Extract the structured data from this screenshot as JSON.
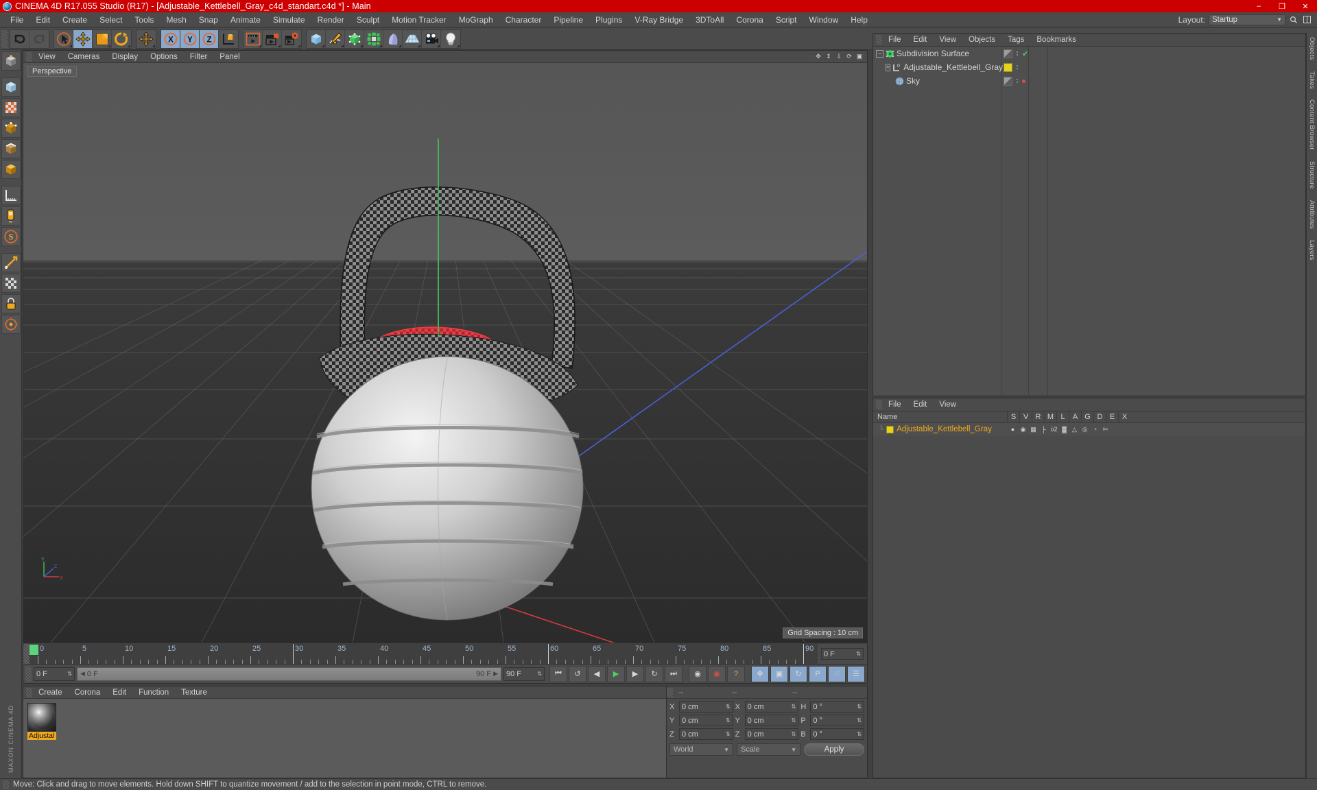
{
  "window": {
    "title": "CINEMA 4D R17.055 Studio (R17) - [Adjustable_Kettlebell_Gray_c4d_standart.c4d *] - Main",
    "minimize": "–",
    "maximize": "❐",
    "close": "✕"
  },
  "menubar": {
    "items": [
      "File",
      "Edit",
      "Create",
      "Select",
      "Tools",
      "Mesh",
      "Snap",
      "Animate",
      "Simulate",
      "Render",
      "Sculpt",
      "Motion Tracker",
      "MoGraph",
      "Character",
      "Pipeline",
      "Plugins",
      "V-Ray Bridge",
      "3DToAll",
      "Corona",
      "Script",
      "Window",
      "Help"
    ],
    "layout_label": "Layout:",
    "layout_value": "Startup",
    "search_icon": "search-icon"
  },
  "viewport": {
    "menu": [
      "View",
      "Cameras",
      "Display",
      "Options",
      "Filter",
      "Panel"
    ],
    "label": "Perspective",
    "grid_spacing": "Grid Spacing : 10 cm",
    "axis": {
      "x": "X",
      "y": "Y",
      "z": "Z"
    }
  },
  "timeline": {
    "tick_labels": [
      "0",
      "5",
      "10",
      "15",
      "20",
      "25",
      "30",
      "35",
      "40",
      "45",
      "50",
      "55",
      "60",
      "65",
      "70",
      "75",
      "80",
      "85",
      "90"
    ],
    "frame_min": 0,
    "frame_max": 90,
    "current_frame_field": "0 F",
    "right_field": "0 F"
  },
  "playback": {
    "current_frame": "0 F",
    "range_start": "0 F",
    "range_end": "90 F",
    "end_field": "90 F",
    "buttons": [
      {
        "name": "go-to-start-button",
        "glyph": "⏮"
      },
      {
        "name": "previous-key-button",
        "glyph": "↺"
      },
      {
        "name": "step-back-button",
        "glyph": "◀"
      },
      {
        "name": "play-button",
        "glyph": "▶"
      },
      {
        "name": "step-forward-button",
        "glyph": "▶"
      },
      {
        "name": "next-key-button",
        "glyph": "↻"
      },
      {
        "name": "go-to-end-button",
        "glyph": "⏭"
      }
    ],
    "record_buttons": [
      {
        "name": "record-active-objects-button",
        "glyph": "◉"
      },
      {
        "name": "autokeying-button",
        "glyph": "◉"
      },
      {
        "name": "keyframe-selection-button",
        "glyph": "?"
      },
      {
        "name": "position-key-button",
        "glyph": "✥"
      },
      {
        "name": "scale-key-button",
        "glyph": "▣"
      },
      {
        "name": "rotation-key-button",
        "glyph": "↻"
      },
      {
        "name": "param-key-button",
        "glyph": "P"
      },
      {
        "name": "pla-key-button",
        "glyph": "⋮⋮"
      },
      {
        "name": "timeline-toggle-button",
        "glyph": "☰"
      }
    ]
  },
  "material_manager": {
    "menu": [
      "Create",
      "Corona",
      "Edit",
      "Function",
      "Texture"
    ],
    "materials": [
      {
        "name": "Adjustal",
        "thumb": "sphere-preview"
      }
    ]
  },
  "coordinates": {
    "header_dashes": [
      "--",
      "--",
      "--"
    ],
    "position": {
      "label_x": "X",
      "label_y": "Y",
      "label_z": "Z",
      "x": "0 cm",
      "y": "0 cm",
      "z": "0 cm"
    },
    "size": {
      "label_x": "X",
      "label_y": "Y",
      "label_z": "Z",
      "x": "0 cm",
      "y": "0 cm",
      "z": "0 cm"
    },
    "rotation": {
      "label_h": "H",
      "label_p": "P",
      "label_b": "B",
      "h": "0 °",
      "p": "0 °",
      "b": "0 °"
    },
    "coord_system": "World",
    "mode": "Scale",
    "apply_label": "Apply"
  },
  "object_manager": {
    "menu": [
      "File",
      "Edit",
      "View",
      "Objects",
      "Tags",
      "Bookmarks"
    ],
    "objects": [
      {
        "name": "Subdivision Surface",
        "icon": "subdivision-surface-icon",
        "indent": 0,
        "expander": "−",
        "tag": "checker",
        "state": "check"
      },
      {
        "name": "Adjustable_Kettlebell_Gray",
        "icon": "null-object-icon",
        "indent": 1,
        "expander": "+",
        "tag": "yellow",
        "state": "none"
      },
      {
        "name": "Sky",
        "icon": "sky-icon",
        "indent": 1,
        "expander": "",
        "tag": "checker",
        "state": "red"
      }
    ]
  },
  "layer_manager": {
    "menu": [
      "File",
      "Edit",
      "View"
    ],
    "columns": [
      "Name",
      "S",
      "V",
      "R",
      "M",
      "L",
      "A",
      "G",
      "D",
      "E",
      "X"
    ],
    "rows": [
      {
        "name": "Adjustable_Kettlebell_Gray",
        "swatch": "#e8d21f",
        "glyphs": [
          "●",
          "◉",
          "▦",
          "├",
          "ὑ2",
          "▓",
          "△",
          "◎",
          "◔",
          "✄"
        ]
      }
    ]
  },
  "right_dock": {
    "tabs": [
      "Objects",
      "Takes",
      "Content Browser",
      "Structure",
      "Attributes",
      "Layers"
    ]
  },
  "status_bar": {
    "message": "Move: Click and drag to move elements. Hold down SHIFT to quantize movement / add to the selection in point mode, CTRL to remove."
  },
  "toolbar": {
    "groups": [
      {
        "name": "history",
        "buttons": [
          {
            "name": "undo-button",
            "icon": "undo-icon",
            "active": false
          },
          {
            "name": "redo-button",
            "icon": "redo-icon",
            "active": false
          }
        ]
      },
      {
        "name": "transform",
        "buttons": [
          {
            "name": "live-selection-button",
            "icon": "cursor-select-icon",
            "active": false
          },
          {
            "name": "move-tool-button",
            "icon": "move-icon",
            "active": true
          },
          {
            "name": "scale-tool-button",
            "icon": "scale-icon",
            "active": false
          },
          {
            "name": "rotate-tool-button",
            "icon": "rotate-icon",
            "active": false
          }
        ]
      },
      {
        "name": "drag",
        "buttons": [
          {
            "name": "drag-tool-button",
            "icon": "move-icon",
            "active": false
          }
        ]
      },
      {
        "name": "axes",
        "buttons": [
          {
            "name": "x-axis-button",
            "icon": "x-axis-icon",
            "active": true
          },
          {
            "name": "y-axis-button",
            "icon": "y-axis-icon",
            "active": true
          },
          {
            "name": "z-axis-button",
            "icon": "z-axis-icon",
            "active": true
          },
          {
            "name": "world-coordinate-button",
            "icon": "world-axis-icon",
            "active": false
          }
        ]
      },
      {
        "name": "render",
        "buttons": [
          {
            "name": "render-view-button",
            "icon": "render-view-icon",
            "active": false
          },
          {
            "name": "render-region-button",
            "icon": "render-region-icon",
            "active": false
          },
          {
            "name": "render-settings-button",
            "icon": "render-settings-icon",
            "active": false
          }
        ]
      },
      {
        "name": "create",
        "buttons": [
          {
            "name": "add-cube-button",
            "icon": "cube-icon",
            "active": false
          },
          {
            "name": "spline-pen-button",
            "icon": "pen-icon",
            "active": false
          },
          {
            "name": "nurbs-button",
            "icon": "nurbs-icon",
            "active": false
          },
          {
            "name": "array-button",
            "icon": "array-icon",
            "active": false
          },
          {
            "name": "deformer-button",
            "icon": "bend-icon",
            "active": false
          },
          {
            "name": "scene-floor-button",
            "icon": "floor-icon",
            "active": false
          },
          {
            "name": "camera-button",
            "icon": "camera-icon",
            "active": false
          },
          {
            "name": "light-button",
            "icon": "light-icon",
            "active": false
          }
        ]
      }
    ]
  },
  "left_toolbar": {
    "buttons": [
      {
        "name": "make-editable-button",
        "icon": "editable-icon"
      },
      {
        "name": "model-mode-button",
        "icon": "model-mode-icon"
      },
      {
        "name": "texture-mode-button",
        "icon": "texture-mode-icon"
      },
      {
        "name": "points-mode-button",
        "icon": "points-mode-icon"
      },
      {
        "name": "edges-mode-button",
        "icon": "edges-mode-icon"
      },
      {
        "name": "polygons-mode-button",
        "icon": "polygons-mode-icon"
      },
      {
        "name": "measure-tool-button",
        "icon": "ruler-icon"
      },
      {
        "name": "workplane-button",
        "icon": "workplane-icon"
      },
      {
        "name": "sculpt-button",
        "icon": "sculpt-s-icon"
      },
      {
        "name": "enable-axis-button",
        "icon": "axis-modify-icon"
      },
      {
        "name": "viewport-solo-button",
        "icon": "checker-icon"
      },
      {
        "name": "lock-button",
        "icon": "lock-icon"
      },
      {
        "name": "snap-button",
        "icon": "snap-icon"
      }
    ],
    "brand": "MAXON CINEMA 4D"
  },
  "colors": {
    "title_bar": "#cc0000",
    "panel": "#4b4b4b",
    "accent_orange": "#f0a81e",
    "active_blue": "#8aa8cc",
    "green_check": "#4cd164",
    "red_dot": "#e04b4b",
    "tag_yellow": "#e8d21f"
  }
}
